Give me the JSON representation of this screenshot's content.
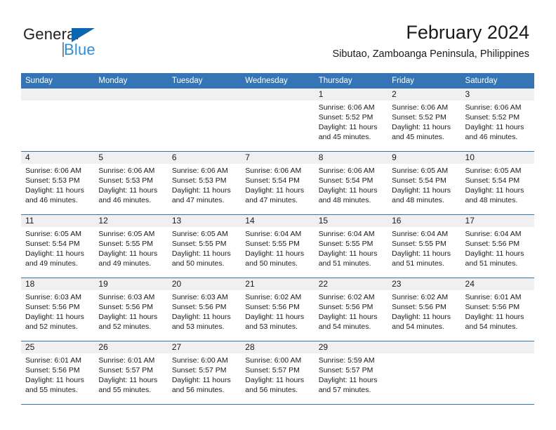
{
  "brand": {
    "name_top": "General",
    "name_bottom": "Blue",
    "accent_color": "#0a66b0",
    "blue_text_color": "#2f8fd6"
  },
  "header": {
    "title": "February 2024",
    "subtitle": "Sibutao, Zamboanga Peninsula, Philippines"
  },
  "calendar": {
    "header_color": "#3575b5",
    "daynum_band_color": "#f0f0f0",
    "weekday_names": [
      "Sunday",
      "Monday",
      "Tuesday",
      "Wednesday",
      "Thursday",
      "Friday",
      "Saturday"
    ],
    "weeks": [
      [
        {
          "day": "",
          "lines": []
        },
        {
          "day": "",
          "lines": []
        },
        {
          "day": "",
          "lines": []
        },
        {
          "day": "",
          "lines": []
        },
        {
          "day": "1",
          "lines": [
            "Sunrise: 6:06 AM",
            "Sunset: 5:52 PM",
            "Daylight: 11 hours and 45 minutes."
          ]
        },
        {
          "day": "2",
          "lines": [
            "Sunrise: 6:06 AM",
            "Sunset: 5:52 PM",
            "Daylight: 11 hours and 45 minutes."
          ]
        },
        {
          "day": "3",
          "lines": [
            "Sunrise: 6:06 AM",
            "Sunset: 5:52 PM",
            "Daylight: 11 hours and 46 minutes."
          ]
        }
      ],
      [
        {
          "day": "4",
          "lines": [
            "Sunrise: 6:06 AM",
            "Sunset: 5:53 PM",
            "Daylight: 11 hours and 46 minutes."
          ]
        },
        {
          "day": "5",
          "lines": [
            "Sunrise: 6:06 AM",
            "Sunset: 5:53 PM",
            "Daylight: 11 hours and 46 minutes."
          ]
        },
        {
          "day": "6",
          "lines": [
            "Sunrise: 6:06 AM",
            "Sunset: 5:53 PM",
            "Daylight: 11 hours and 47 minutes."
          ]
        },
        {
          "day": "7",
          "lines": [
            "Sunrise: 6:06 AM",
            "Sunset: 5:54 PM",
            "Daylight: 11 hours and 47 minutes."
          ]
        },
        {
          "day": "8",
          "lines": [
            "Sunrise: 6:06 AM",
            "Sunset: 5:54 PM",
            "Daylight: 11 hours and 48 minutes."
          ]
        },
        {
          "day": "9",
          "lines": [
            "Sunrise: 6:05 AM",
            "Sunset: 5:54 PM",
            "Daylight: 11 hours and 48 minutes."
          ]
        },
        {
          "day": "10",
          "lines": [
            "Sunrise: 6:05 AM",
            "Sunset: 5:54 PM",
            "Daylight: 11 hours and 48 minutes."
          ]
        }
      ],
      [
        {
          "day": "11",
          "lines": [
            "Sunrise: 6:05 AM",
            "Sunset: 5:54 PM",
            "Daylight: 11 hours and 49 minutes."
          ]
        },
        {
          "day": "12",
          "lines": [
            "Sunrise: 6:05 AM",
            "Sunset: 5:55 PM",
            "Daylight: 11 hours and 49 minutes."
          ]
        },
        {
          "day": "13",
          "lines": [
            "Sunrise: 6:05 AM",
            "Sunset: 5:55 PM",
            "Daylight: 11 hours and 50 minutes."
          ]
        },
        {
          "day": "14",
          "lines": [
            "Sunrise: 6:04 AM",
            "Sunset: 5:55 PM",
            "Daylight: 11 hours and 50 minutes."
          ]
        },
        {
          "day": "15",
          "lines": [
            "Sunrise: 6:04 AM",
            "Sunset: 5:55 PM",
            "Daylight: 11 hours and 51 minutes."
          ]
        },
        {
          "day": "16",
          "lines": [
            "Sunrise: 6:04 AM",
            "Sunset: 5:55 PM",
            "Daylight: 11 hours and 51 minutes."
          ]
        },
        {
          "day": "17",
          "lines": [
            "Sunrise: 6:04 AM",
            "Sunset: 5:56 PM",
            "Daylight: 11 hours and 51 minutes."
          ]
        }
      ],
      [
        {
          "day": "18",
          "lines": [
            "Sunrise: 6:03 AM",
            "Sunset: 5:56 PM",
            "Daylight: 11 hours and 52 minutes."
          ]
        },
        {
          "day": "19",
          "lines": [
            "Sunrise: 6:03 AM",
            "Sunset: 5:56 PM",
            "Daylight: 11 hours and 52 minutes."
          ]
        },
        {
          "day": "20",
          "lines": [
            "Sunrise: 6:03 AM",
            "Sunset: 5:56 PM",
            "Daylight: 11 hours and 53 minutes."
          ]
        },
        {
          "day": "21",
          "lines": [
            "Sunrise: 6:02 AM",
            "Sunset: 5:56 PM",
            "Daylight: 11 hours and 53 minutes."
          ]
        },
        {
          "day": "22",
          "lines": [
            "Sunrise: 6:02 AM",
            "Sunset: 5:56 PM",
            "Daylight: 11 hours and 54 minutes."
          ]
        },
        {
          "day": "23",
          "lines": [
            "Sunrise: 6:02 AM",
            "Sunset: 5:56 PM",
            "Daylight: 11 hours and 54 minutes."
          ]
        },
        {
          "day": "24",
          "lines": [
            "Sunrise: 6:01 AM",
            "Sunset: 5:56 PM",
            "Daylight: 11 hours and 54 minutes."
          ]
        }
      ],
      [
        {
          "day": "25",
          "lines": [
            "Sunrise: 6:01 AM",
            "Sunset: 5:56 PM",
            "Daylight: 11 hours and 55 minutes."
          ]
        },
        {
          "day": "26",
          "lines": [
            "Sunrise: 6:01 AM",
            "Sunset: 5:57 PM",
            "Daylight: 11 hours and 55 minutes."
          ]
        },
        {
          "day": "27",
          "lines": [
            "Sunrise: 6:00 AM",
            "Sunset: 5:57 PM",
            "Daylight: 11 hours and 56 minutes."
          ]
        },
        {
          "day": "28",
          "lines": [
            "Sunrise: 6:00 AM",
            "Sunset: 5:57 PM",
            "Daylight: 11 hours and 56 minutes."
          ]
        },
        {
          "day": "29",
          "lines": [
            "Sunrise: 5:59 AM",
            "Sunset: 5:57 PM",
            "Daylight: 11 hours and 57 minutes."
          ]
        },
        {
          "day": "",
          "lines": []
        },
        {
          "day": "",
          "lines": []
        }
      ]
    ]
  }
}
